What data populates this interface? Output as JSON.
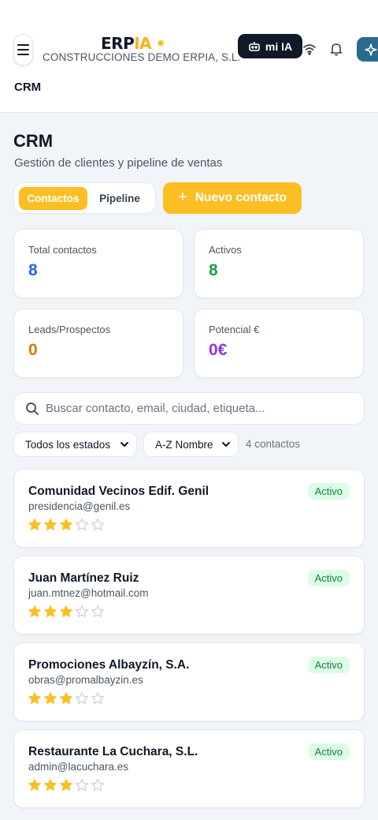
{
  "header": {
    "logo_main": "ERP",
    "logo_accent": "IA",
    "company": "CONSTRUCCIONES DEMO ERPIA, S.L.",
    "ia_button_label": "mi IA",
    "breadcrumb": "CRM"
  },
  "page": {
    "title": "CRM",
    "subtitle": "Gestión de clientes y pipeline de ventas"
  },
  "tabs": [
    {
      "label": "Contactos",
      "active": true
    },
    {
      "label": "Pipeline",
      "active": false
    }
  ],
  "new_contact_label": "Nuevo contacto",
  "stats": [
    {
      "label": "Total contactos",
      "value": "8",
      "color": "#2563eb"
    },
    {
      "label": "Activos",
      "value": "8",
      "color": "#16a34a"
    },
    {
      "label": "Leads/Prospectos",
      "value": "0",
      "color": "#d97706"
    },
    {
      "label": "Potencial €",
      "value": "0€",
      "color": "#9333ea"
    }
  ],
  "search": {
    "placeholder": "Buscar contacto, email, ciudad, etiqueta...",
    "value": ""
  },
  "filters": {
    "status_selected": "Todos los estados",
    "sort_selected": "A-Z Nombre",
    "count_text": "4 contactos"
  },
  "contacts": [
    {
      "name": "Comunidad Vecinos Edif. Genil",
      "email": "presidencia@genil.es",
      "status": "Activo",
      "rating": 3,
      "max_rating": 5
    },
    {
      "name": "Juan Martínez Ruiz",
      "email": "juan.mtnez@hotmail.com",
      "status": "Activo",
      "rating": 3,
      "max_rating": 5
    },
    {
      "name": "Promociones Albayzín, S.A.",
      "email": "obras@promalbayzin.es",
      "status": "Activo",
      "rating": 3,
      "max_rating": 5
    },
    {
      "name": "Restaurante La Cuchara, S.L.",
      "email": "admin@lacuchara.es",
      "status": "Activo",
      "rating": 3,
      "max_rating": 5
    }
  ],
  "colors": {
    "accent": "#fbbf24",
    "dark": "#111827",
    "star_filled": "#fbbf24",
    "star_empty": "#d1d5db",
    "badge_bg": "#dcfce7",
    "badge_text": "#15803d"
  },
  "icons": {
    "menu": "menu-icon",
    "robot": "robot-icon",
    "wifi": "wifi-icon",
    "bell": "bell-icon",
    "sparkle": "sparkle-icon",
    "search": "search-icon",
    "chevron": "chevron-down-icon",
    "star": "star-icon"
  }
}
